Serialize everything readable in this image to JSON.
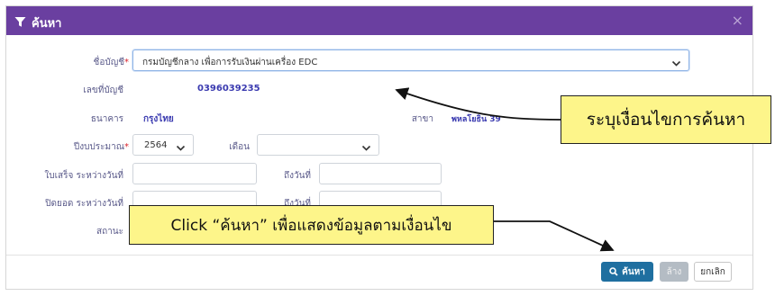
{
  "dialog": {
    "title": "ค้นหา",
    "close_symbol": "×"
  },
  "form": {
    "account_name_label": "ชื่อบัญชี",
    "account_name_value": "กรมบัญชีกลาง เพื่อการรับเงินผ่านเครื่อง EDC",
    "account_no_label": "เลขที่บัญชี",
    "account_no_value": "0396039235",
    "bank_label": "ธนาคาร",
    "bank_value": "กรุงไทย",
    "branch_label": "สาขา",
    "branch_value": "พหลโยธิน 39",
    "fiscal_year_label": "ปีงบประมาณ",
    "fiscal_year_value": "2564",
    "month_label": "เดือน",
    "month_value": "",
    "receipt_from_label": "ใบเสร็จ ระหว่างวันที่",
    "receipt_to_label": "ถึงวันที่",
    "close_from_label": "ปิดยอด ระหว่างวันที่",
    "close_to_label": "ถึงวันที่",
    "status_label": "สถานะ",
    "required_mark": "*"
  },
  "buttons": {
    "search_label": "ค้นหา",
    "clear_label": "ล้าง",
    "cancel_label": "ยกเลิก"
  },
  "callouts": {
    "condition_note": "ระบุเงื่อนไขการค้นหา",
    "search_note": "Click “ค้นหา” เพื่อแสดงข้อมูลตามเงื่อนไข"
  },
  "colors": {
    "titlebar": "#6a3fa0",
    "primary_button": "#1f6fa0",
    "callout_fill": "#fdf58a",
    "value_text": "#3b3bb0"
  },
  "icons": [
    "filter-icon",
    "close-icon",
    "chevron-down-icon",
    "search-icon"
  ]
}
